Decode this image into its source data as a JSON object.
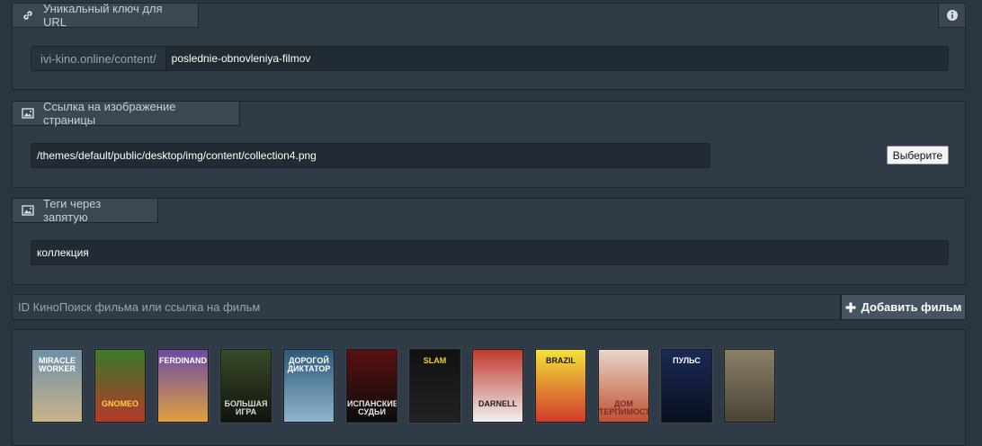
{
  "url_key": {
    "tab_label": "Уникальный ключ для URL",
    "prefix": "ivi-kino.online/content/",
    "value": "poslednie-obnovleniya-filmov"
  },
  "image_link": {
    "tab_label": "Ссылка на изображение страницы",
    "value": "/themes/default/public/desktop/img/content/collection4.png",
    "button_label": "Выберите"
  },
  "tags": {
    "tab_label": "Теги через запятую",
    "value": "коллекция"
  },
  "film_search": {
    "placeholder": "ID КиноПоиск фильма или ссылка на фильм",
    "add_button_label": "Добавить фильм"
  },
  "films": [
    {
      "title": "MIRACLE WORKER",
      "colors": [
        "#6d8fa6",
        "#c9b48a"
      ],
      "accent": "#ffffff"
    },
    {
      "title": "GNOMEO",
      "colors": [
        "#3a7a2b",
        "#b33a2a"
      ],
      "accent": "#ffd24a"
    },
    {
      "title": "FERDINAND",
      "colors": [
        "#6b4aa6",
        "#e0a040"
      ],
      "accent": "#ffffff"
    },
    {
      "title": "БОЛЬШАЯ ИГРА",
      "colors": [
        "#3a4a2a",
        "#0f140c"
      ],
      "accent": "#d9d9d9"
    },
    {
      "title": "ДОРОГОЙ ДИКТАТОР",
      "colors": [
        "#2c5a7a",
        "#8fb5cc"
      ],
      "accent": "#ffffff"
    },
    {
      "title": "ИСПАНСКИЕ СУДЬИ",
      "colors": [
        "#5a1010",
        "#0c0c0c"
      ],
      "accent": "#e6e6e6"
    },
    {
      "title": "SLAM",
      "colors": [
        "#111111",
        "#222222"
      ],
      "accent": "#f3d21a"
    },
    {
      "title": "DARNELL",
      "colors": [
        "#c0392b",
        "#f0f0f0"
      ],
      "accent": "#222222"
    },
    {
      "title": "BRAZIL",
      "colors": [
        "#f3e23a",
        "#d13a2a"
      ],
      "accent": "#1a1a1a"
    },
    {
      "title": "ДОМ ТЕРПИМОСТИ",
      "colors": [
        "#e9d6cc",
        "#c05030"
      ],
      "accent": "#7a2a2a"
    },
    {
      "title": "ПУЛЬС",
      "colors": [
        "#1a2a55",
        "#0a0f20"
      ],
      "accent": "#ffffff"
    },
    {
      "title": "",
      "colors": [
        "#8a8068",
        "#4a4436"
      ],
      "accent": "#f0e6c8"
    }
  ]
}
